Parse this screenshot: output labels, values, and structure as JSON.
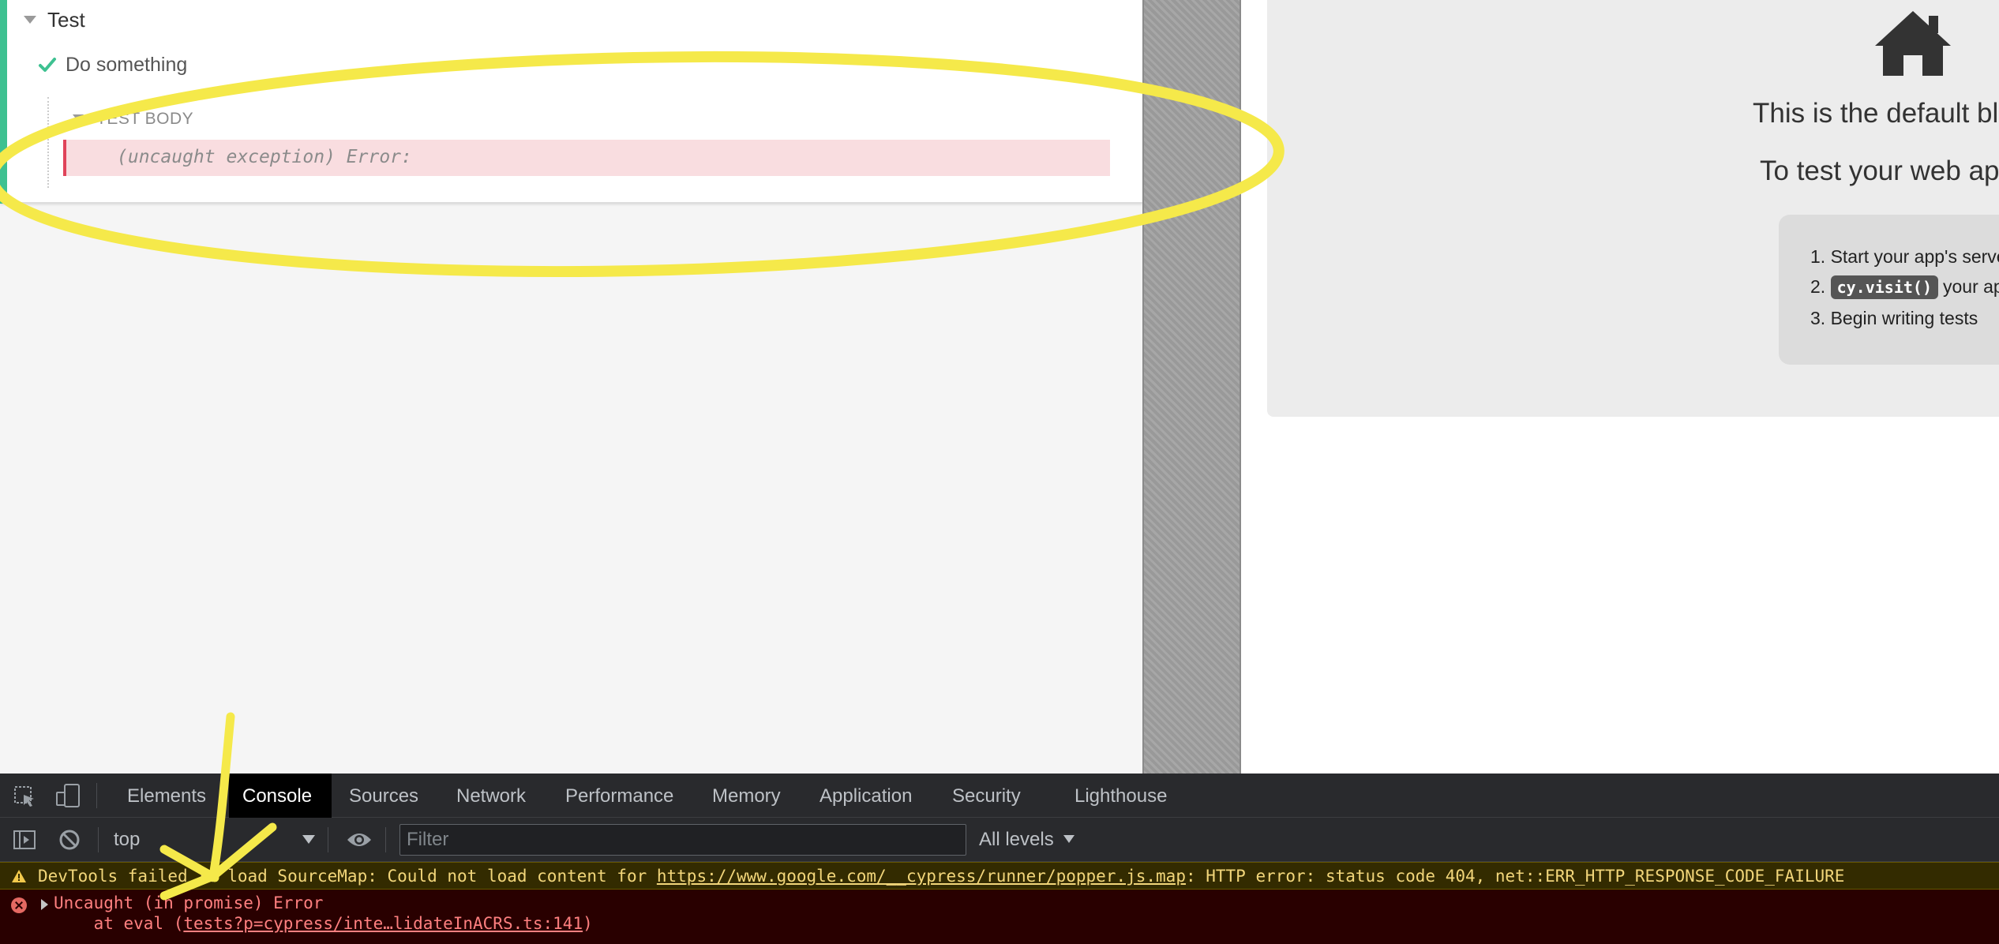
{
  "reporter": {
    "suite_title": "Test",
    "test_title": "Do something",
    "body_label": "TEST BODY",
    "error_text": "(uncaught exception) Error:"
  },
  "app_preview": {
    "title": "This is the default blank",
    "subtitle": "To test your web applic",
    "steps": [
      {
        "number": "1.",
        "text": "Start your app's server"
      },
      {
        "number": "2.",
        "code": "cy.visit()",
        "text": "your app"
      },
      {
        "number": "3.",
        "text": "Begin writing tests"
      }
    ],
    "icon": "home-icon"
  },
  "devtools": {
    "tabs": [
      "Elements",
      "Console",
      "Sources",
      "Network",
      "Performance",
      "Memory",
      "Application",
      "Security",
      "Lighthouse"
    ],
    "active_tab": "Console",
    "context": "top",
    "filter_placeholder": "Filter",
    "filter_value": "",
    "levels": "All levels",
    "messages": {
      "warning_prefix": "DevTools failed to load SourceMap: Could not load content for ",
      "warning_link": "https://www.google.com/__cypress/runner/popper.js.map",
      "warning_suffix": ": HTTP error: status code 404, net::ERR_HTTP_RESPONSE_CODE_FAILURE",
      "error_line1": "Uncaught (in promise) Error",
      "error_line2_prefix": "    at eval (",
      "error_line2_link": "tests?p=cypress/inte…lidateInACRS.ts:141",
      "error_line2_suffix": ")"
    }
  },
  "colors": {
    "pass_green": "#3ec191",
    "error_red": "#e0445a",
    "annotation_yellow": "#f5e94a",
    "devtools_bg": "#202124"
  }
}
